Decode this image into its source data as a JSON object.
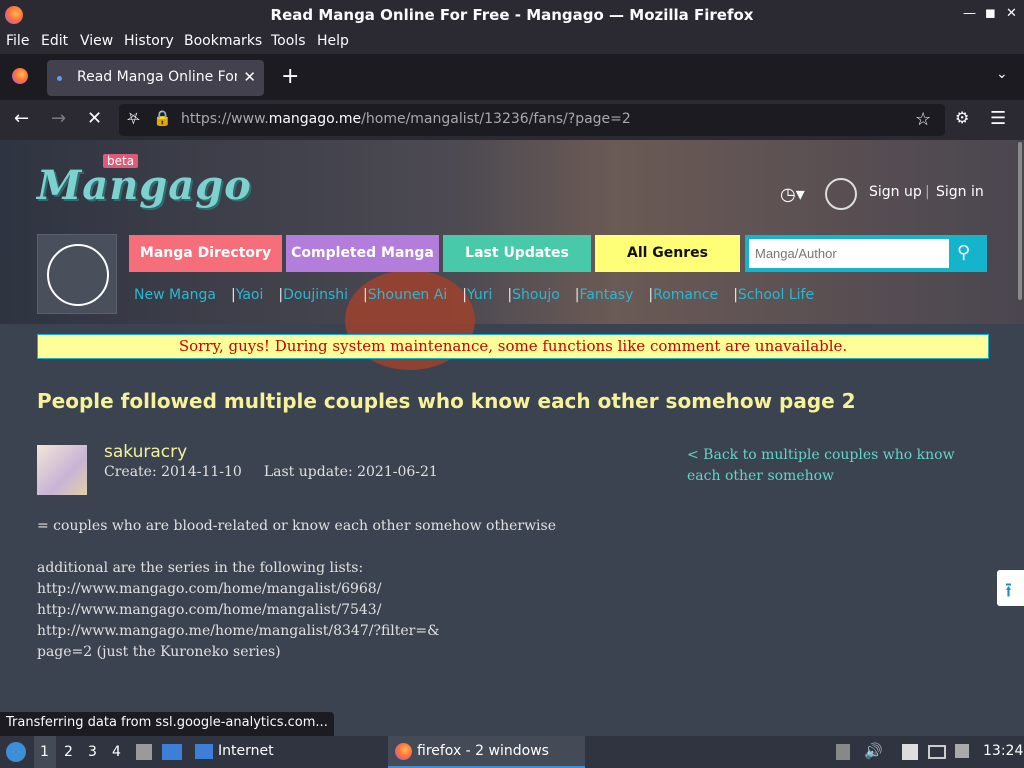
{
  "window": {
    "title": "Read Manga Online For Free - Mangago — Mozilla Firefox"
  },
  "menu": {
    "file": "File",
    "edit": "Edit",
    "view": "View",
    "history": "History",
    "bookmarks": "Bookmarks",
    "tools": "Tools",
    "help": "Help"
  },
  "tab": {
    "label": "Read Manga Online For Free - Mangago"
  },
  "url": {
    "prefix": "https://www.",
    "host": "mangago.me",
    "path": "/home/mangalist/13236/fans/?page=2"
  },
  "site": {
    "logo": "Mangago",
    "beta": "beta",
    "signup": "Sign up",
    "signin": "Sign in",
    "user_sep": "|",
    "buttons": [
      {
        "label": "Manga Directory",
        "color": "#f56e7a"
      },
      {
        "label": "Completed Manga",
        "color": "#b27ddb"
      },
      {
        "label": "Last Updates",
        "color": "#48c9a9"
      },
      {
        "label": "All Genres",
        "color": "#ffff77"
      }
    ],
    "search_placeholder": "Manga/Author",
    "sublinks": [
      "New Manga",
      "Yaoi",
      "Doujinshi",
      "Shounen Ai",
      "Yuri",
      "Shoujo",
      "Fantasy",
      "Romance",
      "School Life"
    ]
  },
  "notice": "Sorry, guys! During system maintenance, some functions like comment are unavailable.",
  "list": {
    "title": "People followed multiple couples who know each other somehow page 2",
    "author": "sakuracry",
    "create": "Create: 2014-11-10",
    "update": "Last update: 2021-06-21",
    "back": "< Back to multiple couples who know each other somehow",
    "desc": "= couples who are blood-related or know each other somehow otherwise\n\nadditional are the series in the following lists:\nhttp://www.mangago.com/home/mangalist/6968/\nhttp://www.mangago.com/home/mangalist/7543/\nhttp://www.mangago.me/home/mangalist/8347/?filter=&\npage=2 (just the Kuroneko series)"
  },
  "status": "Transferring data from ssl.google-analytics.com...",
  "taskbar": {
    "ws": [
      "1",
      "2",
      "3",
      "4"
    ],
    "internet": "Internet",
    "firefox": "firefox - 2 windows",
    "time": "13:24"
  }
}
